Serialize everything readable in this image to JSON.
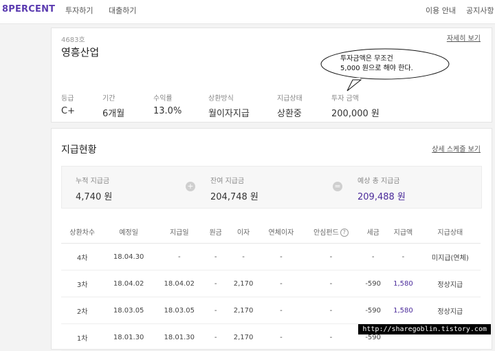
{
  "nav": {
    "logo": "8PERCENT",
    "invest": "투자하기",
    "loan": "대출하기",
    "guide": "이용 안내",
    "notice": "공지사항"
  },
  "loan": {
    "number": "4683호",
    "name": "영흥산업",
    "detail_link": "자세히 보기",
    "facts": [
      {
        "label": "등급",
        "value": "C+"
      },
      {
        "label": "기간",
        "value": "6개월"
      },
      {
        "label": "수익률",
        "value": "13.0%"
      },
      {
        "label": "상환방식",
        "value": "월이자지급"
      },
      {
        "label": "지급상태",
        "value": "상환중"
      },
      {
        "label": "투자 금액",
        "value": "200,000 원"
      }
    ]
  },
  "annotation": {
    "line1": "투자금액은 무조건",
    "line2": "5,000 원으로 해야 한다."
  },
  "payment": {
    "title": "지급현황",
    "schedule_link": "상세 스케줄 보기",
    "summary": {
      "paid_label": "누적 지급금",
      "paid_value": "4,740 원",
      "remain_label": "잔여 지급금",
      "remain_value": "204,748 원",
      "total_label": "예상 총 지급금",
      "total_value": "209,488 원"
    },
    "columns": [
      "상환차수",
      "예정일",
      "지급일",
      "원금",
      "이자",
      "연체이자",
      "안심펀드",
      "세금",
      "지급액",
      "지급상태"
    ],
    "rows": [
      [
        "4차",
        "18.04.30",
        "-",
        "-",
        "-",
        "-",
        "-",
        "-",
        "-",
        "미지급(연체)"
      ],
      [
        "3차",
        "18.04.02",
        "18.04.02",
        "-",
        "2,170",
        "-",
        "-",
        "-590",
        "1,580",
        "정상지급"
      ],
      [
        "2차",
        "18.03.05",
        "18.03.05",
        "-",
        "2,170",
        "-",
        "-",
        "-590",
        "1,580",
        "정상지급"
      ],
      [
        "1차",
        "18.01.30",
        "18.01.30",
        "-",
        "2,170",
        "-",
        "-",
        "-590",
        "",
        ""
      ]
    ]
  },
  "watermark": "http://sharegoblin.tistory.com",
  "colors": {
    "brand": "#5b3bb0",
    "accent": "#4a2a9a"
  }
}
